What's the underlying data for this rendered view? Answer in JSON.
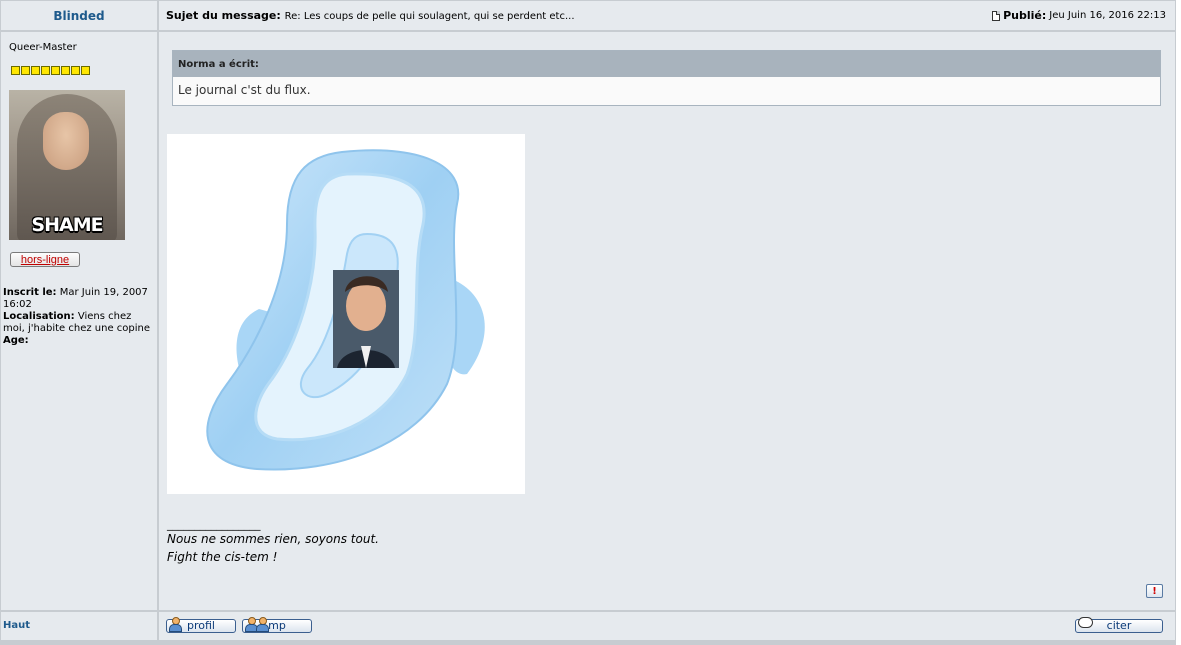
{
  "post": {
    "author": "Blinded",
    "subject_label": "Sujet du message:",
    "subject": "Re: Les coups de pelle qui soulagent, qui se perdent etc...",
    "posted_label": "Publié:",
    "posted_date": "Jeu Juin 16, 2016 22:13",
    "quote": {
      "header": "Norma a écrit:",
      "text": "Le journal c'st du flux."
    },
    "signature_separator": "_________________",
    "signature_lines": [
      "Nous ne sommes rien, soyons tout.",
      "Fight the cis-tem !"
    ],
    "report_label": "!"
  },
  "user": {
    "rank": "Queer-Master",
    "star_count": 8,
    "avatar_caption": "SHAME",
    "status": "hors-ligne",
    "registered_label": "Inscrit le:",
    "registered_value": "Mar Juin 19, 2007 16:02",
    "location_label": "Localisation:",
    "location_value": "Viens chez moi, j'habite chez une copine",
    "age_label": "Age:"
  },
  "footer": {
    "top_link": "Haut",
    "profile_button": "profil",
    "pm_button": "mp",
    "quote_button": "citer"
  },
  "colors": {
    "author_blue": "#1e5a8c",
    "panel_bg": "#e6eaee",
    "border_bg": "#c7ccd1",
    "quote_header": "#a8b3bd",
    "star_yellow": "#ffe600",
    "offline_red": "#c00000"
  }
}
